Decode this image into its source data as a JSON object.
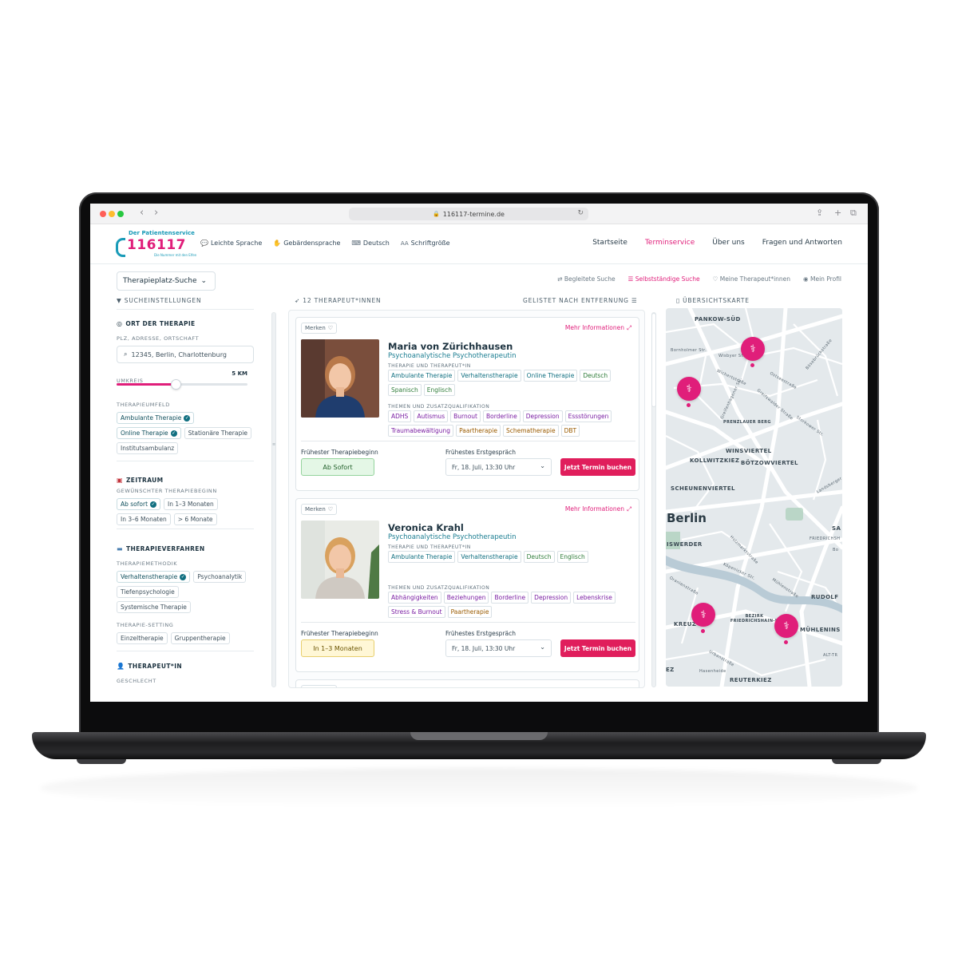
{
  "browser": {
    "url": "116117-termine.de"
  },
  "logo": {
    "subtitle": "Der Patientenservice",
    "number": "116117",
    "tagline": "Die Nummer mit den Elfen"
  },
  "header": {
    "accessibility_links": [
      {
        "icon": "chat-icon",
        "label": "Leichte Sprache"
      },
      {
        "icon": "sign-language-icon",
        "label": "Gebärdensprache"
      },
      {
        "icon": "language-icon",
        "label": "Deutsch"
      },
      {
        "icon": "font-size-icon",
        "label": "Schriftgröße"
      }
    ],
    "nav": [
      "Startseite",
      "Terminservice",
      "Über uns",
      "Fragen und Antworten"
    ],
    "nav_active": "Terminservice"
  },
  "toolbar": {
    "search_mode": "Therapieplatz-Suche",
    "subnav": [
      "Begleitete Suche",
      "Selbstständige Suche",
      "Meine Therapeut*innen",
      "Mein Profil"
    ],
    "subnav_active": "Selbstständige Suche"
  },
  "columns": {
    "filters_title": "SUCHEINSTELLUNGEN",
    "results_title": "12 THERAPEUT*INNEN",
    "sort_label": "GELISTET NACH ENTFERNUNG",
    "map_title": "ÜBERSICHTSKARTE"
  },
  "filters": {
    "location": {
      "title": "ORT DER THERAPIE",
      "field_label": "PLZ, ADRESSE, ORTSCHAFT",
      "value": "12345, Berlin, Charlottenburg",
      "radius_label": "UMKREIS",
      "radius_value": "5 KM",
      "radius_fraction": 0.45,
      "setting_label": "THERAPIEUMFELD",
      "settings": [
        {
          "label": "Ambulante Therapie",
          "selected": true
        },
        {
          "label": "Online Therapie",
          "selected": true
        },
        {
          "label": "Stationäre Therapie",
          "selected": false
        },
        {
          "label": "Institutsambulanz",
          "selected": false
        }
      ]
    },
    "time": {
      "title": "ZEITRAUM",
      "field_label": "GEWÜNSCHTER THERAPIEBEGINN",
      "options": [
        {
          "label": "Ab sofort",
          "selected": true
        },
        {
          "label": "In 1–3 Monaten",
          "selected": false
        },
        {
          "label": "In 3–6 Monaten",
          "selected": false
        },
        {
          "label": "> 6 Monate",
          "selected": false
        }
      ]
    },
    "method": {
      "title": "THERAPIEVERFAHREN",
      "field_label": "THERAPIEMETHODIK",
      "options": [
        {
          "label": "Verhaltenstherapie",
          "selected": true
        },
        {
          "label": "Psychoanalytik",
          "selected": false
        },
        {
          "label": "Tiefenpsychologie",
          "selected": false
        },
        {
          "label": "Systemische Therapie",
          "selected": false
        }
      ],
      "setting_label": "THERAPIE-SETTING",
      "settings": [
        {
          "label": "Einzeltherapie",
          "selected": false
        },
        {
          "label": "Gruppentherapie",
          "selected": false
        }
      ]
    },
    "therapist": {
      "title": "THERAPEUT*IN",
      "field_label": "GESCHLECHT"
    }
  },
  "results": {
    "save_label": "Merken",
    "more_label": "Mehr Informationen",
    "therapy_label": "THERAPIE UND THERAPEUT*IN",
    "topics_label": "THEMEN UND ZUSATZQUALIFIKATION",
    "start_label": "Frühester Therapiebeginn",
    "consult_label": "Frühestes Erstgespräch",
    "book_label": "Jetzt Termin buchen",
    "cards": [
      {
        "name": "Maria von Zürichhausen",
        "profession": "Psychoanalytische Psychotherapeutin",
        "therapy_tags": [
          {
            "label": "Ambulante Therapie",
            "color": "teal"
          },
          {
            "label": "Verhaltenstherapie",
            "color": "teal"
          },
          {
            "label": "Online Therapie",
            "color": "teal"
          },
          {
            "label": "Deutsch",
            "color": "green"
          },
          {
            "label": "Spanisch",
            "color": "green"
          },
          {
            "label": "Englisch",
            "color": "green"
          }
        ],
        "topic_tags": [
          {
            "label": "ADHS",
            "color": "purple"
          },
          {
            "label": "Autismus",
            "color": "purple"
          },
          {
            "label": "Burnout",
            "color": "purple"
          },
          {
            "label": "Borderline",
            "color": "purple"
          },
          {
            "label": "Depression",
            "color": "purple"
          },
          {
            "label": "Essstörungen",
            "color": "purple"
          },
          {
            "label": "Traumabewältigung",
            "color": "purple"
          },
          {
            "label": "Paartherapie",
            "color": "orange"
          },
          {
            "label": "Schematherapie",
            "color": "orange"
          },
          {
            "label": "DBT",
            "color": "orange"
          }
        ],
        "earliest_start": "Ab Sofort",
        "start_style": "green",
        "earliest_consult": "Fr, 18. Juli, 13:30 Uhr"
      },
      {
        "name": "Veronica Krahl",
        "profession": "Psychoanalytische Psychotherapeutin",
        "therapy_tags": [
          {
            "label": "Ambulante Therapie",
            "color": "teal"
          },
          {
            "label": "Verhaltenstherapie",
            "color": "teal"
          },
          {
            "label": "Deutsch",
            "color": "green"
          },
          {
            "label": "Englisch",
            "color": "green"
          }
        ],
        "topic_tags": [
          {
            "label": "Abhängigkeiten",
            "color": "purple"
          },
          {
            "label": "Beziehungen",
            "color": "purple"
          },
          {
            "label": "Borderline",
            "color": "purple"
          },
          {
            "label": "Depression",
            "color": "purple"
          },
          {
            "label": "Lebenskrise",
            "color": "purple"
          },
          {
            "label": "Stress & Burnout",
            "color": "purple"
          },
          {
            "label": "Paartherapie",
            "color": "orange"
          }
        ],
        "earliest_start": "In 1–3 Monaten",
        "start_style": "yellow",
        "earliest_consult": "Fr, 18. Juli, 13:30 Uhr"
      }
    ]
  },
  "map": {
    "labels": [
      "PANKOW-SÜD",
      "Bornholmer Str.",
      "Wisbyer Str.",
      "Bösebrückstraße",
      "Wichertstraße",
      "Ostseestraße",
      "Greifenhagener Str.",
      "Greifswalder Straße",
      "PRENZLAUER BERG",
      "Storkower Str.",
      "WINSVIERTEL",
      "KOLLWITZKIEZ",
      "BÖTZOWVIERTEL",
      "SCHEUNENVIERTEL",
      "Landsberger Allee",
      "Berlin",
      "SA",
      "FRIEDRICHSH",
      "ISWERDER",
      "Bo",
      "Holzmarktstraße",
      "Köpenicker Str.",
      "Oranienstraße",
      "Mühlenstraße",
      "RUDOLF",
      "KREUZ",
      "BEZIRK FRIEDRICHSHAIN-K",
      "MÜHLENINS",
      "ALT-TR",
      "Urbanstraße",
      "Hasenheide",
      "EZ",
      "REUTERKIEZ"
    ]
  }
}
